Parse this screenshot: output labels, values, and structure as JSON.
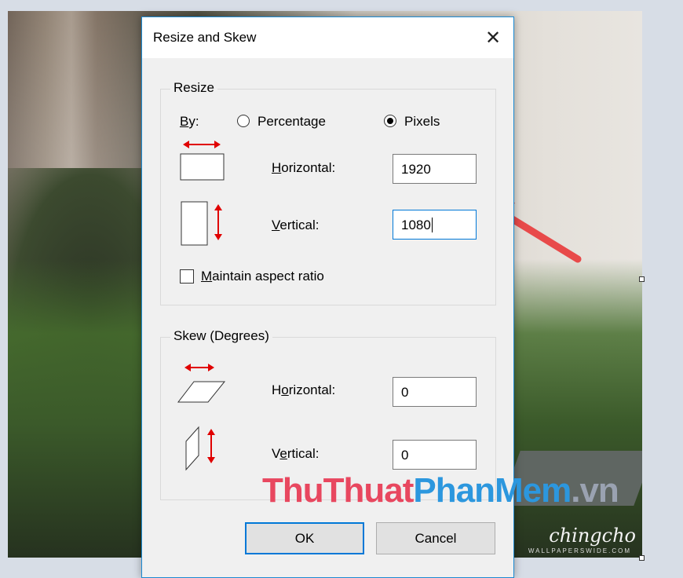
{
  "dialog": {
    "title": "Resize and Skew",
    "close_glyph": "✕",
    "resize": {
      "legend": "Resize",
      "by_label_u": "B",
      "by_label_rest": "y:",
      "percentage_label": "Percentage",
      "pixels_label": "Pixels",
      "selected": "Pixels",
      "horizontal_label_u": "H",
      "horizontal_label_rest": "orizontal:",
      "horizontal_value": "1920",
      "vertical_label_u": "V",
      "vertical_label_rest": "ertical:",
      "vertical_value": "1080",
      "maintain_u": "M",
      "maintain_rest": "aintain aspect ratio",
      "maintain_checked": false
    },
    "skew": {
      "legend": "Skew (Degrees)",
      "horizontal_label_pre": "H",
      "horizontal_label_u": "o",
      "horizontal_label_rest": "rizontal:",
      "horizontal_value": "0",
      "vertical_label_pre": "V",
      "vertical_label_u": "e",
      "vertical_label_rest": "rtical:",
      "vertical_value": "0"
    },
    "ok_label": "OK",
    "cancel_label": "Cancel"
  },
  "watermark": {
    "part1": "ThuThuat",
    "part2": "PhanMem",
    "part3": ".vn"
  },
  "signature": {
    "name": "chingcho",
    "sub": "WALLPAPERSWIDE.COM"
  },
  "colors": {
    "accent": "#0078d7",
    "arrow": "#e84a4a",
    "indicator": "#e00000"
  }
}
